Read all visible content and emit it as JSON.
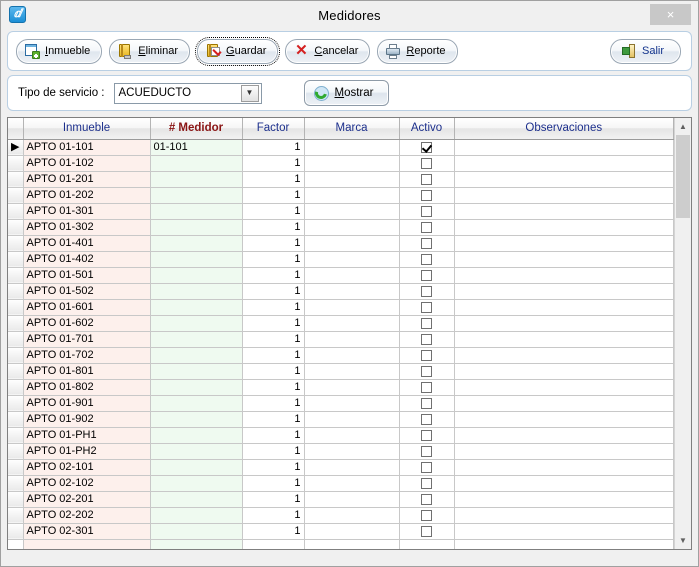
{
  "window": {
    "title": "Medidores",
    "app_icon": "app-icon",
    "close_label": "×"
  },
  "toolbar": {
    "buttons": [
      {
        "id": "inmueble",
        "label_before": "",
        "accel": "I",
        "label_after": "nmueble",
        "icon": "form-add-icon"
      },
      {
        "id": "eliminar",
        "label_before": "",
        "accel": "E",
        "label_after": "liminar",
        "icon": "delete-icon"
      },
      {
        "id": "guardar",
        "label_before": "",
        "accel": "G",
        "label_after": "uardar",
        "icon": "save-icon",
        "focused": true
      },
      {
        "id": "cancelar",
        "label_before": "",
        "accel": "C",
        "label_after": "ancelar",
        "icon": "cancel-x-icon"
      },
      {
        "id": "reporte",
        "label_before": "",
        "accel": "R",
        "label_after": "eporte",
        "icon": "printer-icon"
      }
    ],
    "exit": {
      "id": "salir",
      "label": "Salir",
      "icon": "exit-door-icon"
    }
  },
  "filter": {
    "label": "Tipo de servicio :",
    "combo": {
      "value": "ACUEDUCTO",
      "arrow_glyph": "▼",
      "options": [
        "ACUEDUCTO"
      ]
    },
    "show_button": {
      "accel": "M",
      "label_after": "ostrar",
      "icon": "refresh-icon"
    }
  },
  "grid": {
    "columns": [
      "Inmueble",
      "# Medidor",
      "Factor",
      "Marca",
      "Activo",
      "Observaciones"
    ],
    "row_indicator": "▶",
    "rows": [
      {
        "inmueble": "APTO 01-101",
        "medidor": "01-101",
        "factor": "1",
        "marca": "",
        "activo": true,
        "observaciones": "",
        "selected": true
      },
      {
        "inmueble": "APTO 01-102",
        "medidor": "",
        "factor": "1",
        "marca": "",
        "activo": false,
        "observaciones": "",
        "selected": false
      },
      {
        "inmueble": "APTO 01-201",
        "medidor": "",
        "factor": "1",
        "marca": "",
        "activo": false,
        "observaciones": "",
        "selected": false
      },
      {
        "inmueble": "APTO 01-202",
        "medidor": "",
        "factor": "1",
        "marca": "",
        "activo": false,
        "observaciones": "",
        "selected": false
      },
      {
        "inmueble": "APTO 01-301",
        "medidor": "",
        "factor": "1",
        "marca": "",
        "activo": false,
        "observaciones": "",
        "selected": false
      },
      {
        "inmueble": "APTO 01-302",
        "medidor": "",
        "factor": "1",
        "marca": "",
        "activo": false,
        "observaciones": "",
        "selected": false
      },
      {
        "inmueble": "APTO 01-401",
        "medidor": "",
        "factor": "1",
        "marca": "",
        "activo": false,
        "observaciones": "",
        "selected": false
      },
      {
        "inmueble": "APTO 01-402",
        "medidor": "",
        "factor": "1",
        "marca": "",
        "activo": false,
        "observaciones": "",
        "selected": false
      },
      {
        "inmueble": "APTO 01-501",
        "medidor": "",
        "factor": "1",
        "marca": "",
        "activo": false,
        "observaciones": "",
        "selected": false
      },
      {
        "inmueble": "APTO 01-502",
        "medidor": "",
        "factor": "1",
        "marca": "",
        "activo": false,
        "observaciones": "",
        "selected": false
      },
      {
        "inmueble": "APTO 01-601",
        "medidor": "",
        "factor": "1",
        "marca": "",
        "activo": false,
        "observaciones": "",
        "selected": false
      },
      {
        "inmueble": "APTO 01-602",
        "medidor": "",
        "factor": "1",
        "marca": "",
        "activo": false,
        "observaciones": "",
        "selected": false
      },
      {
        "inmueble": "APTO 01-701",
        "medidor": "",
        "factor": "1",
        "marca": "",
        "activo": false,
        "observaciones": "",
        "selected": false
      },
      {
        "inmueble": "APTO 01-702",
        "medidor": "",
        "factor": "1",
        "marca": "",
        "activo": false,
        "observaciones": "",
        "selected": false
      },
      {
        "inmueble": "APTO 01-801",
        "medidor": "",
        "factor": "1",
        "marca": "",
        "activo": false,
        "observaciones": "",
        "selected": false
      },
      {
        "inmueble": "APTO 01-802",
        "medidor": "",
        "factor": "1",
        "marca": "",
        "activo": false,
        "observaciones": "",
        "selected": false
      },
      {
        "inmueble": "APTO 01-901",
        "medidor": "",
        "factor": "1",
        "marca": "",
        "activo": false,
        "observaciones": "",
        "selected": false
      },
      {
        "inmueble": "APTO 01-902",
        "medidor": "",
        "factor": "1",
        "marca": "",
        "activo": false,
        "observaciones": "",
        "selected": false
      },
      {
        "inmueble": "APTO 01-PH1",
        "medidor": "",
        "factor": "1",
        "marca": "",
        "activo": false,
        "observaciones": "",
        "selected": false
      },
      {
        "inmueble": "APTO 01-PH2",
        "medidor": "",
        "factor": "1",
        "marca": "",
        "activo": false,
        "observaciones": "",
        "selected": false
      },
      {
        "inmueble": "APTO 02-101",
        "medidor": "",
        "factor": "1",
        "marca": "",
        "activo": false,
        "observaciones": "",
        "selected": false
      },
      {
        "inmueble": "APTO 02-102",
        "medidor": "",
        "factor": "1",
        "marca": "",
        "activo": false,
        "observaciones": "",
        "selected": false
      },
      {
        "inmueble": "APTO 02-201",
        "medidor": "",
        "factor": "1",
        "marca": "",
        "activo": false,
        "observaciones": "",
        "selected": false
      },
      {
        "inmueble": "APTO 02-202",
        "medidor": "",
        "factor": "1",
        "marca": "",
        "activo": false,
        "observaciones": "",
        "selected": false
      },
      {
        "inmueble": "APTO 02-301",
        "medidor": "",
        "factor": "1",
        "marca": "",
        "activo": false,
        "observaciones": "",
        "selected": false
      },
      {
        "inmueble": "",
        "medidor": "",
        "factor": "",
        "marca": "",
        "activo": null,
        "observaciones": "",
        "selected": false
      }
    ]
  },
  "scrollbar": {
    "up_glyph": "▲",
    "down_glyph": "▼"
  },
  "colors": {
    "header_text": "#1c2f8c",
    "medidor_header_text": "#8a1414",
    "inmueble_cell": "#fdf0ec",
    "medidor_cell": "#effaf0",
    "exit_text": "#12338c"
  }
}
